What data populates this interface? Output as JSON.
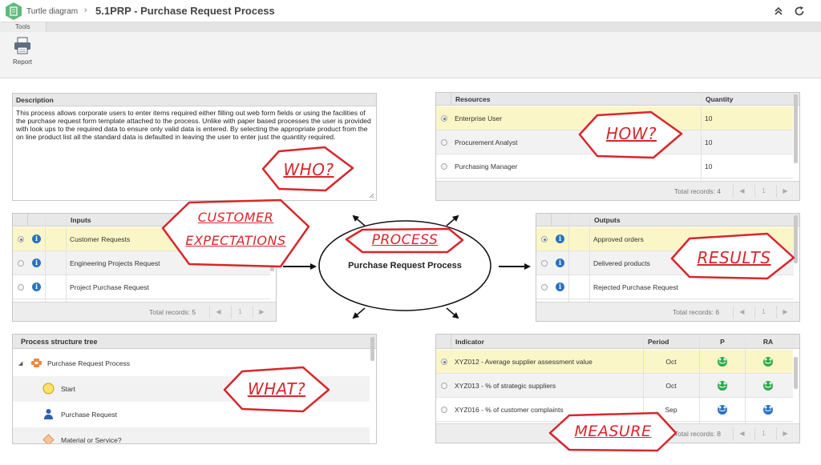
{
  "header": {
    "breadcrumb": "Turtle diagram",
    "separator": "›",
    "title": "5.1PRP - Purchase Request Process",
    "collapse_icon": "double-chevron-up-icon",
    "refresh_icon": "refresh-icon"
  },
  "toolbar": {
    "tab_label": "Tools",
    "report_label": "Report",
    "report_icon": "printer-icon"
  },
  "description": {
    "title": "Description",
    "text": "This process allows corporate users to enter items required either filling out web form fields or using the facilities of the purchase request form template attached to the process. Unlike with paper based processes the user is provided with look ups to the required data to ensure only valid data is entered. By selecting the appropriate product from the on line product list all the standard data is defaulted in leaving the user to enter just the quantity required."
  },
  "resources": {
    "col_resources": "Resources",
    "col_quantity": "Quantity",
    "rows": [
      {
        "name": "Enterprise User",
        "quantity": "10"
      },
      {
        "name": "Procurement Analyst",
        "quantity": "10"
      },
      {
        "name": "Purchasing Manager",
        "quantity": "10"
      }
    ],
    "total": "Total records: 4",
    "page": "1"
  },
  "inputs": {
    "col_inputs": "Inputs",
    "rows": [
      {
        "name": "Customer Requests"
      },
      {
        "name": "Engineering Projects Request"
      },
      {
        "name": "Project Purchase Request"
      }
    ],
    "total": "Total records: 5",
    "page": "1"
  },
  "outputs": {
    "col_outputs": "Outputs",
    "rows": [
      {
        "name": "Approved orders"
      },
      {
        "name": "Delivered products"
      },
      {
        "name": "Rejected Purchase Request"
      }
    ],
    "total": "Total records: 6",
    "page": "1"
  },
  "process": {
    "name": "Purchase Request Process"
  },
  "tree": {
    "title": "Process structure tree",
    "items": [
      {
        "label": "Purchase Request Process",
        "icon": "process-icon"
      },
      {
        "label": "Start",
        "icon": "start-event-icon"
      },
      {
        "label": "Purchase Request",
        "icon": "user-task-icon"
      },
      {
        "label": "Material or Service?",
        "icon": "gateway-icon"
      }
    ]
  },
  "indicators": {
    "col_indicator": "Indicator",
    "col_period": "Period",
    "col_p": "P",
    "col_ra": "RA",
    "rows": [
      {
        "name": "XYZ012 - Average supplier assessment value",
        "period": "Oct",
        "p": "good",
        "ra": "good"
      },
      {
        "name": "XYZ013 - % of strategic suppliers",
        "period": "Oct",
        "p": "good",
        "ra": "good"
      },
      {
        "name": "XYZ016 - % of customer complaints",
        "period": "Sep",
        "p": "neutral",
        "ra": "neutral"
      }
    ],
    "total": "Total records: 8",
    "page": "1"
  },
  "annotations": {
    "who": "WHO?",
    "how": "HOW?",
    "customer_line1": "CUSTOMER",
    "customer_line2": "EXPECTATIONS",
    "process": "PROCESS",
    "results": "RESULTS",
    "what": "WHAT?",
    "measure": "MEASURE",
    "color": "#d8262c"
  },
  "colors": {
    "accent_green": "#5fba7d",
    "info_blue": "#2a72c0",
    "selected_row": "#fbf6c7",
    "smile_green": "#2eaa4a",
    "smile_blue": "#2a72c0"
  }
}
